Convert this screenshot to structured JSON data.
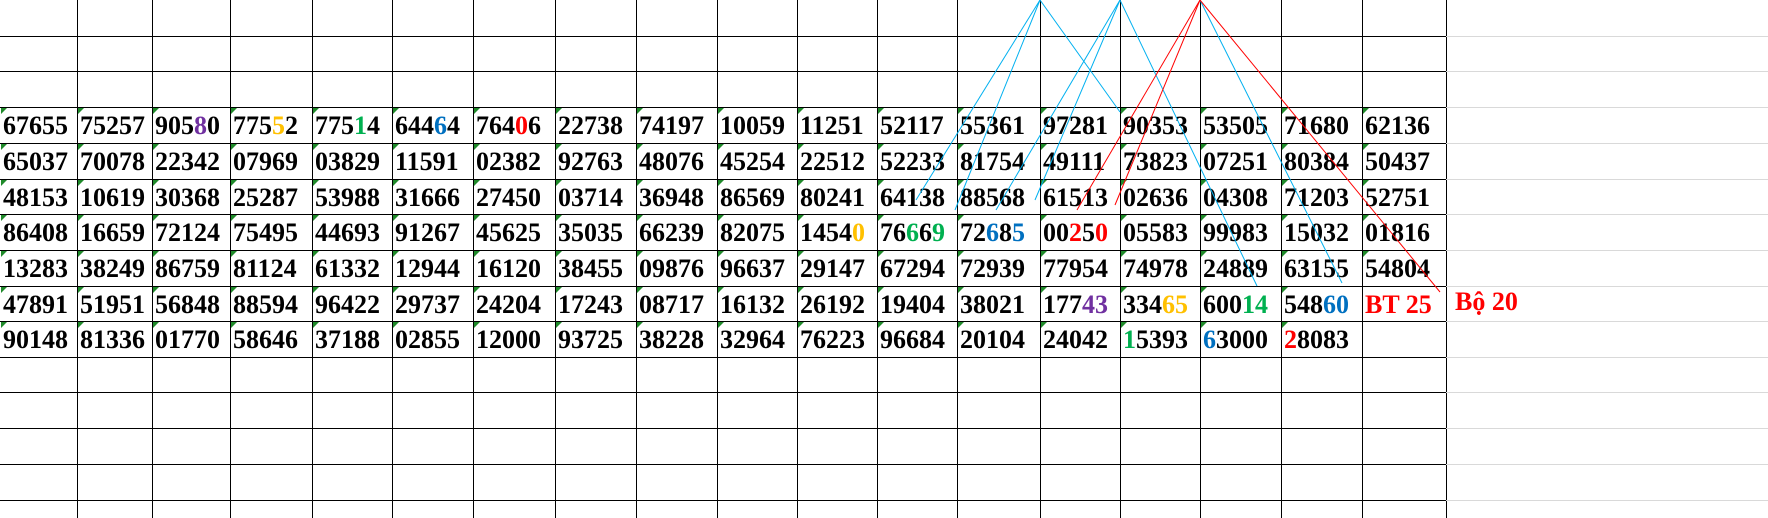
{
  "sheet": {
    "rows": [
      [
        [
          {
            "t": "67655"
          }
        ],
        [
          {
            "t": "75257"
          }
        ],
        [
          {
            "t": "905"
          },
          {
            "t": "8",
            "c": "purple"
          },
          {
            "t": "0"
          }
        ],
        [
          {
            "t": "775"
          },
          {
            "t": "5",
            "c": "orange"
          },
          {
            "t": "2"
          }
        ],
        [
          {
            "t": "775"
          },
          {
            "t": "1",
            "c": "green"
          },
          {
            "t": "4"
          }
        ],
        [
          {
            "t": "644"
          },
          {
            "t": "6",
            "c": "blue"
          },
          {
            "t": "4"
          }
        ],
        [
          {
            "t": "764"
          },
          {
            "t": "0",
            "c": "red"
          },
          {
            "t": "6"
          }
        ],
        [
          {
            "t": "22738"
          }
        ],
        [
          {
            "t": "74197"
          }
        ],
        [
          {
            "t": "10059"
          }
        ],
        [
          {
            "t": "11251"
          }
        ],
        [
          {
            "t": "52117"
          }
        ],
        [
          {
            "t": "55361"
          }
        ],
        [
          {
            "t": "97281"
          }
        ],
        [
          {
            "t": "90353"
          }
        ],
        [
          {
            "t": "53505"
          }
        ],
        [
          {
            "t": "71680"
          }
        ],
        [
          {
            "t": "62136"
          }
        ]
      ],
      [
        [
          {
            "t": "65037"
          }
        ],
        [
          {
            "t": "70078"
          }
        ],
        [
          {
            "t": "22342"
          }
        ],
        [
          {
            "t": "07969"
          }
        ],
        [
          {
            "t": "03829"
          }
        ],
        [
          {
            "t": "11591"
          }
        ],
        [
          {
            "t": "02382"
          }
        ],
        [
          {
            "t": "92763"
          }
        ],
        [
          {
            "t": "48076"
          }
        ],
        [
          {
            "t": "45254"
          }
        ],
        [
          {
            "t": "22512"
          }
        ],
        [
          {
            "t": "52233"
          }
        ],
        [
          {
            "t": "81754"
          }
        ],
        [
          {
            "t": "49111"
          }
        ],
        [
          {
            "t": "73823"
          }
        ],
        [
          {
            "t": "07251"
          }
        ],
        [
          {
            "t": "80384"
          }
        ],
        [
          {
            "t": "50437"
          }
        ]
      ],
      [
        [
          {
            "t": "48153"
          }
        ],
        [
          {
            "t": "10619"
          }
        ],
        [
          {
            "t": "30368"
          }
        ],
        [
          {
            "t": "25287"
          }
        ],
        [
          {
            "t": "53988"
          }
        ],
        [
          {
            "t": "31666"
          }
        ],
        [
          {
            "t": "27450"
          }
        ],
        [
          {
            "t": "03714"
          }
        ],
        [
          {
            "t": "36948"
          }
        ],
        [
          {
            "t": "86569"
          }
        ],
        [
          {
            "t": "80241"
          }
        ],
        [
          {
            "t": "64138"
          }
        ],
        [
          {
            "t": "88568"
          }
        ],
        [
          {
            "t": "61513"
          }
        ],
        [
          {
            "t": "02636"
          }
        ],
        [
          {
            "t": "04308"
          }
        ],
        [
          {
            "t": "71203"
          }
        ],
        [
          {
            "t": "52751"
          }
        ]
      ],
      [
        [
          {
            "t": "86408"
          }
        ],
        [
          {
            "t": "16659"
          }
        ],
        [
          {
            "t": "72124"
          }
        ],
        [
          {
            "t": "75495"
          }
        ],
        [
          {
            "t": "44693"
          }
        ],
        [
          {
            "t": "91267"
          }
        ],
        [
          {
            "t": "45625"
          }
        ],
        [
          {
            "t": "35035"
          }
        ],
        [
          {
            "t": "66239"
          }
        ],
        [
          {
            "t": "82075"
          }
        ],
        [
          {
            "t": "1454"
          },
          {
            "t": "0",
            "c": "orange"
          }
        ],
        [
          {
            "t": "76"
          },
          {
            "t": "6",
            "c": "green"
          },
          {
            "t": "6"
          },
          {
            "t": "9",
            "c": "green"
          }
        ],
        [
          {
            "t": "72"
          },
          {
            "t": "6",
            "c": "blue"
          },
          {
            "t": "8"
          },
          {
            "t": "5",
            "c": "blue"
          }
        ],
        [
          {
            "t": "00"
          },
          {
            "t": "2",
            "c": "red"
          },
          {
            "t": "5"
          },
          {
            "t": "0",
            "c": "red"
          }
        ],
        [
          {
            "t": "05583"
          }
        ],
        [
          {
            "t": "99983"
          }
        ],
        [
          {
            "t": "15032"
          }
        ],
        [
          {
            "t": "01816"
          }
        ]
      ],
      [
        [
          {
            "t": "13283"
          }
        ],
        [
          {
            "t": "38249"
          }
        ],
        [
          {
            "t": "86759"
          }
        ],
        [
          {
            "t": "81124"
          }
        ],
        [
          {
            "t": "61332"
          }
        ],
        [
          {
            "t": "12944"
          }
        ],
        [
          {
            "t": "16120"
          }
        ],
        [
          {
            "t": "38455"
          }
        ],
        [
          {
            "t": "09876"
          }
        ],
        [
          {
            "t": "96637"
          }
        ],
        [
          {
            "t": "29147"
          }
        ],
        [
          {
            "t": "67294"
          }
        ],
        [
          {
            "t": "72939"
          }
        ],
        [
          {
            "t": "77954"
          }
        ],
        [
          {
            "t": "74978"
          }
        ],
        [
          {
            "t": "24889"
          }
        ],
        [
          {
            "t": "63155"
          }
        ],
        [
          {
            "t": "54804"
          }
        ]
      ],
      [
        [
          {
            "t": "47891"
          }
        ],
        [
          {
            "t": "51951"
          }
        ],
        [
          {
            "t": "56848"
          }
        ],
        [
          {
            "t": "88594"
          }
        ],
        [
          {
            "t": "96422"
          }
        ],
        [
          {
            "t": "29737"
          }
        ],
        [
          {
            "t": "24204"
          }
        ],
        [
          {
            "t": "17243"
          }
        ],
        [
          {
            "t": "08717"
          }
        ],
        [
          {
            "t": "16132"
          }
        ],
        [
          {
            "t": "26192"
          }
        ],
        [
          {
            "t": "19404"
          }
        ],
        [
          {
            "t": "38021"
          }
        ],
        [
          {
            "t": "177"
          },
          {
            "t": "43",
            "c": "purple"
          }
        ],
        [
          {
            "t": "334"
          },
          {
            "t": "65",
            "c": "orange"
          }
        ],
        [
          {
            "t": "600"
          },
          {
            "t": "14",
            "c": "green"
          }
        ],
        [
          {
            "t": "548"
          },
          {
            "t": "60",
            "c": "blue"
          }
        ],
        [
          {
            "t": "BT 25",
            "c": "red"
          }
        ]
      ],
      [
        [
          {
            "t": "90148"
          }
        ],
        [
          {
            "t": "81336"
          }
        ],
        [
          {
            "t": "01770"
          }
        ],
        [
          {
            "t": "58646"
          }
        ],
        [
          {
            "t": "37188"
          }
        ],
        [
          {
            "t": "02855"
          }
        ],
        [
          {
            "t": "12000"
          }
        ],
        [
          {
            "t": "93725"
          }
        ],
        [
          {
            "t": "38228"
          }
        ],
        [
          {
            "t": "32964"
          }
        ],
        [
          {
            "t": "76223"
          }
        ],
        [
          {
            "t": "96684"
          }
        ],
        [
          {
            "t": "20104"
          }
        ],
        [
          {
            "t": "24042"
          }
        ],
        [
          {
            "t": "1",
            "c": "green"
          },
          {
            "t": "5393"
          }
        ],
        [
          {
            "t": "6",
            "c": "blue"
          },
          {
            "t": "3000"
          }
        ],
        [
          {
            "t": "2",
            "c": "red"
          },
          {
            "t": "8083"
          }
        ],
        []
      ]
    ],
    "side_note": "Bộ 20"
  },
  "colors": {
    "grid": "#000000",
    "text": "#000000",
    "red": "#ff0000",
    "purple": "#7030a0",
    "orange": "#ffc000",
    "green": "#00b050",
    "blue": "#0070c0",
    "line_blue": "#00b0f0",
    "line_red": "#ff0000",
    "corner_marker": "#1f8a2a"
  }
}
